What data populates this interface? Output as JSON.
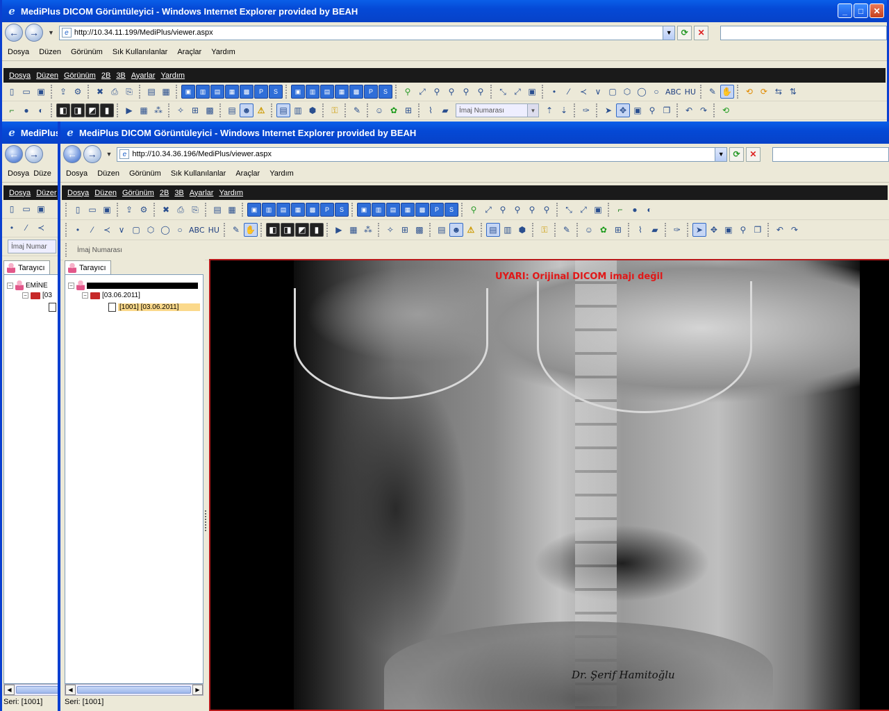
{
  "back_window": {
    "title": "MediPlus DICOM Görüntüleyici - Windows Internet Explorer provided by BEAH",
    "url": "http://10.34.11.199/MediPlus/viewer.aspx",
    "menu": [
      "Dosya",
      "Düzen",
      "Görünüm",
      "Sık Kullanılanlar",
      "Araçlar",
      "Yardım"
    ],
    "app_menu": [
      "Dosya",
      "Düzen",
      "Görünüm",
      "2B",
      "3B",
      "Ayarlar",
      "Yardım"
    ],
    "toolbar_combo": "İmaj Numarası",
    "text_tools": [
      "ABC",
      "HU"
    ]
  },
  "mid_window": {
    "title": "MediPlus",
    "menu": [
      "Dosya",
      "Düze"
    ],
    "app_menu": [
      "Dosya",
      "Düzer"
    ],
    "combo": "İmaj Numar",
    "tab": "Tarayıcı",
    "tree": {
      "patient": "EMİNE",
      "study": "[03",
      "series": ""
    },
    "status": "Seri: [1001]"
  },
  "front_window": {
    "title": "MediPlus DICOM Görüntüleyici - Windows Internet Explorer provided by BEAH",
    "url": "http://10.34.36.196/MediPlus/viewer.aspx",
    "menu": [
      "Dosya",
      "Düzen",
      "Görünüm",
      "Sık Kullanılanlar",
      "Araçlar",
      "Yardım"
    ],
    "app_menu": [
      "Dosya",
      "Düzen",
      "Görünüm",
      "2B",
      "3B",
      "Ayarlar",
      "Yardım"
    ],
    "text_tools": [
      "ABC",
      "HU"
    ],
    "toolbar_combo": "İmaj Numarası",
    "tab": "Tarayıcı",
    "tree": {
      "study": "[03.06.2011]",
      "series": "[1001] [03.06.2011]"
    },
    "status": "Seri: [1001]",
    "viewer": {
      "warning": "UYARI: Orijinal DICOM imajı değil",
      "signature": "Dr. Şerif Hamitoğlu"
    }
  },
  "colors": {
    "titlebar": "#0549d6",
    "warning": "#e01818",
    "viewer_border": "#b8181a",
    "selection": "#fbd98b"
  }
}
